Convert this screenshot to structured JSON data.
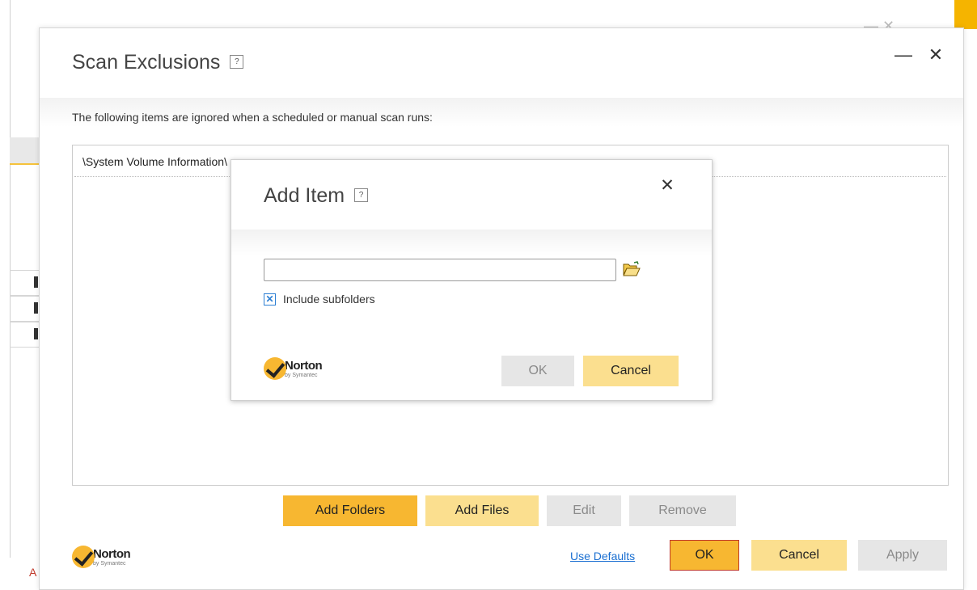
{
  "background": {
    "ghost_controls": "— ✕",
    "partial_letter": "A"
  },
  "dialog": {
    "title": "Scan Exclusions",
    "help_label": "?",
    "minimize_label": "—",
    "close_label": "✕",
    "description": "The following items are ignored when a scheduled or manual scan runs:",
    "list_items": [
      "\\System Volume Information\\"
    ],
    "buttons": {
      "add_folders": "Add Folders",
      "add_files": "Add Files",
      "edit": "Edit",
      "remove": "Remove"
    },
    "footer": {
      "use_defaults": "Use Defaults",
      "ok": "OK",
      "cancel": "Cancel",
      "apply": "Apply"
    }
  },
  "logo": {
    "name": "Norton",
    "tagline": "by Symantec"
  },
  "modal": {
    "title": "Add Item",
    "help_label": "?",
    "close_label": "✕",
    "path_value": "",
    "browse_icon": "folder-open-icon",
    "include_subfolders_label": "Include subfolders",
    "include_subfolders_checked": true,
    "checkbox_mark": "✕",
    "ok": "OK",
    "cancel": "Cancel"
  },
  "colors": {
    "accent": "#f7b731",
    "accent_light": "#fbdf8f",
    "disabled": "#e6e6e6",
    "link": "#1a6fd1",
    "focus_border": "#c0392b"
  }
}
